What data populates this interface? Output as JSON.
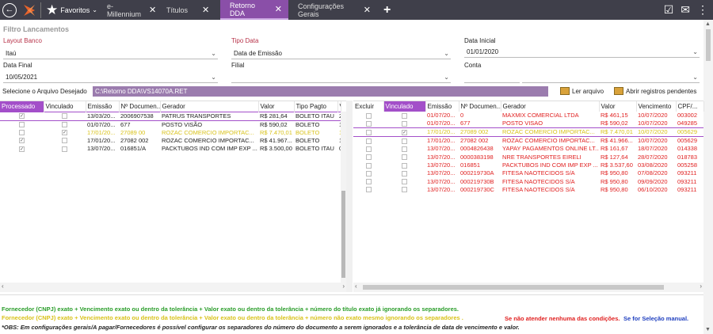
{
  "topbar": {
    "favorites": "Favoritos",
    "tabs": [
      {
        "label": "e-Millennium"
      },
      {
        "label": "Títulos"
      },
      {
        "label": "Retorno DDA"
      },
      {
        "label": "Configurações Gerais"
      }
    ],
    "icons": [
      "back-icon",
      "logo-icon",
      "star-icon",
      "plus-icon",
      "clipboard-icon",
      "chat-icon",
      "more-icon"
    ]
  },
  "filter": {
    "title": "Filtro Lancamentos",
    "layout_banco_label": "Layout Banco",
    "layout_banco_value": "Itaú",
    "tipo_data_label": "Tipo Data",
    "tipo_data_value": "Data de Emissão",
    "data_inicial_label": "Data Inicial",
    "data_inicial_value": "01/01/2020",
    "data_final_label": "Data Final",
    "data_final_value": "10/05/2021",
    "filial_label": "Filial",
    "filial_value": "",
    "conta_label": "Conta",
    "conta_value": ""
  },
  "file": {
    "label": "Selecione o Arquivo Desejado",
    "path": "C:\\Retorno DDA\\VS14070A.RET",
    "read_btn": "Ler arquivo",
    "open_pending_btn": "Abrir registros pendentes"
  },
  "left_grid": {
    "headers": [
      "Processado",
      "Vinculado",
      "Emissão",
      "Nº Documen...",
      "Gerador",
      "Valor",
      "Tipo Pagto",
      "V"
    ],
    "rows": [
      {
        "processado": "✓",
        "vinculado": "",
        "emissao": "13/03/20...",
        "doc": "2006907538",
        "gerador": "PATRUS TRANSPORTES",
        "valor": "R$ 281,64",
        "tipo": "BOLETO ITAU",
        "v": "2",
        "style": "r-black",
        "outlined": true
      },
      {
        "processado": "",
        "vinculado": "",
        "emissao": "01/07/20...",
        "doc": "677",
        "gerador": "POSTO VISÃO",
        "valor": "R$ 590,02",
        "tipo": "BOLETO",
        "v": "1",
        "style": "r-black",
        "outlined": false
      },
      {
        "processado": "",
        "vinculado": "✓",
        "emissao": "17/01/20...",
        "doc": "27089 00",
        "gerador": "ROZAC COMERCIO IMPORTAC...",
        "valor": "R$ 7.470,01",
        "tipo": "BOLETO",
        "v": "1",
        "style": "r-yellow",
        "outlined": false
      },
      {
        "processado": "✓",
        "vinculado": "",
        "emissao": "17/01/20...",
        "doc": "27082 002",
        "gerador": "ROZAC COMERCIO IMPORTAC...",
        "valor": "R$ 41.967...",
        "tipo": "BOLETO",
        "v": "1",
        "style": "r-black",
        "outlined": false
      },
      {
        "processado": "✓",
        "vinculado": "",
        "emissao": "13/07/20...",
        "doc": "016851/A",
        "gerador": "PACKTUBOS IND COM IMP EXP ...",
        "valor": "R$ 3.500,00",
        "tipo": "BOLETO ITAU",
        "v": "0",
        "style": "r-black",
        "outlined": false
      }
    ]
  },
  "right_grid": {
    "headers": [
      "Excluir",
      "Vinculado",
      "Emissão",
      "Nº Documen...",
      "Gerador",
      "Valor",
      "Vencimento",
      "CPF/..."
    ],
    "rows": [
      {
        "excluir": "",
        "vinculado": "",
        "emissao": "01/07/20...",
        "doc": "0",
        "gerador": "MAXMIX COMERCIAL LTDA",
        "valor": "R$ 461,15",
        "venc": "10/07/2020",
        "cpf": "003002",
        "style": "r-red",
        "outlined": false
      },
      {
        "excluir": "",
        "vinculado": "",
        "emissao": "01/07/20...",
        "doc": "677",
        "gerador": "POSTO VISAO",
        "valor": "R$ 590,02",
        "venc": "10/07/2020",
        "cpf": "049285",
        "style": "r-red",
        "outlined": false
      },
      {
        "excluir": "",
        "vinculado": "✓",
        "emissao": "17/01/20...",
        "doc": "27089 002",
        "gerador": "ROZAC COMERCIO IMPORTAC...",
        "valor": "R$ 7.470,01",
        "venc": "10/07/2020",
        "cpf": "005629",
        "style": "r-yellow",
        "outlined": true
      },
      {
        "excluir": "",
        "vinculado": "",
        "emissao": "17/01/20...",
        "doc": "27082 002",
        "gerador": "ROZAC COMERCIO IMPORTAC...",
        "valor": "R$ 41.966...",
        "venc": "10/07/2020",
        "cpf": "005629",
        "style": "r-red",
        "outlined": false
      },
      {
        "excluir": "",
        "vinculado": "",
        "emissao": "13/07/20...",
        "doc": "0004826438",
        "gerador": "YAPAY PAGAMENTOS ONLINE LT...",
        "valor": "R$ 161,67",
        "venc": "18/07/2020",
        "cpf": "014338",
        "style": "r-red",
        "outlined": false
      },
      {
        "excluir": "",
        "vinculado": "",
        "emissao": "13/07/20...",
        "doc": "0000383198",
        "gerador": "NRE TRANSPORTES EIRELI",
        "valor": "R$ 127,64",
        "venc": "28/07/2020",
        "cpf": "018783",
        "style": "r-red",
        "outlined": false
      },
      {
        "excluir": "",
        "vinculado": "",
        "emissao": "13/07/20...",
        "doc": "016851",
        "gerador": "PACKTUBOS IND COM IMP EXP ...",
        "valor": "R$ 3.537,60",
        "venc": "03/08/2020",
        "cpf": "005258",
        "style": "r-red",
        "outlined": false
      },
      {
        "excluir": "",
        "vinculado": "",
        "emissao": "13/07/20...",
        "doc": "000219730A",
        "gerador": "FITESA NAOTECIDOS S/A",
        "valor": "R$ 950,80",
        "venc": "07/08/2020",
        "cpf": "093211",
        "style": "r-red",
        "outlined": false
      },
      {
        "excluir": "",
        "vinculado": "",
        "emissao": "13/07/20...",
        "doc": "000219730B",
        "gerador": "FITESA NAOTECIDOS S/A",
        "valor": "R$ 950,80",
        "venc": "09/09/2020",
        "cpf": "093211",
        "style": "r-red",
        "outlined": false
      },
      {
        "excluir": "",
        "vinculado": "",
        "emissao": "13/07/20...",
        "doc": "000219730C",
        "gerador": "FITESA NAOTECIDOS S/A",
        "valor": "R$ 950,80",
        "venc": "06/10/2020",
        "cpf": "093211",
        "style": "r-red",
        "outlined": false
      }
    ]
  },
  "legend": {
    "green": "Fornecedor (CNPJ) exato + Vencimento exato ou dentro da tolerância + Valor exato ou dentro da tolerância + número do título exato já ignorando os separadores.",
    "yellow": "Fornecedor (CNPJ) exato + Vencimento exato ou dentro da tolerância + Valor exato ou dentro da tolerância + número não exato mesmo ignorando os separadores .",
    "red": "Se não atender nenhuma das condições.",
    "blue": "Se for Seleção manual.",
    "obs": "*OBS: Em configurações gerais/A pagar/Fornecedores é possível configurar os separadores do número do documento a serem ignorados e a tolerância de data de vencimento e valor."
  },
  "colors": {
    "accent": "#a34fc9",
    "topbar": "#3f3f4a",
    "green": "#2a9d2a",
    "yellow": "#d8c21a",
    "red": "#e02020",
    "blue": "#1f3fbf"
  }
}
